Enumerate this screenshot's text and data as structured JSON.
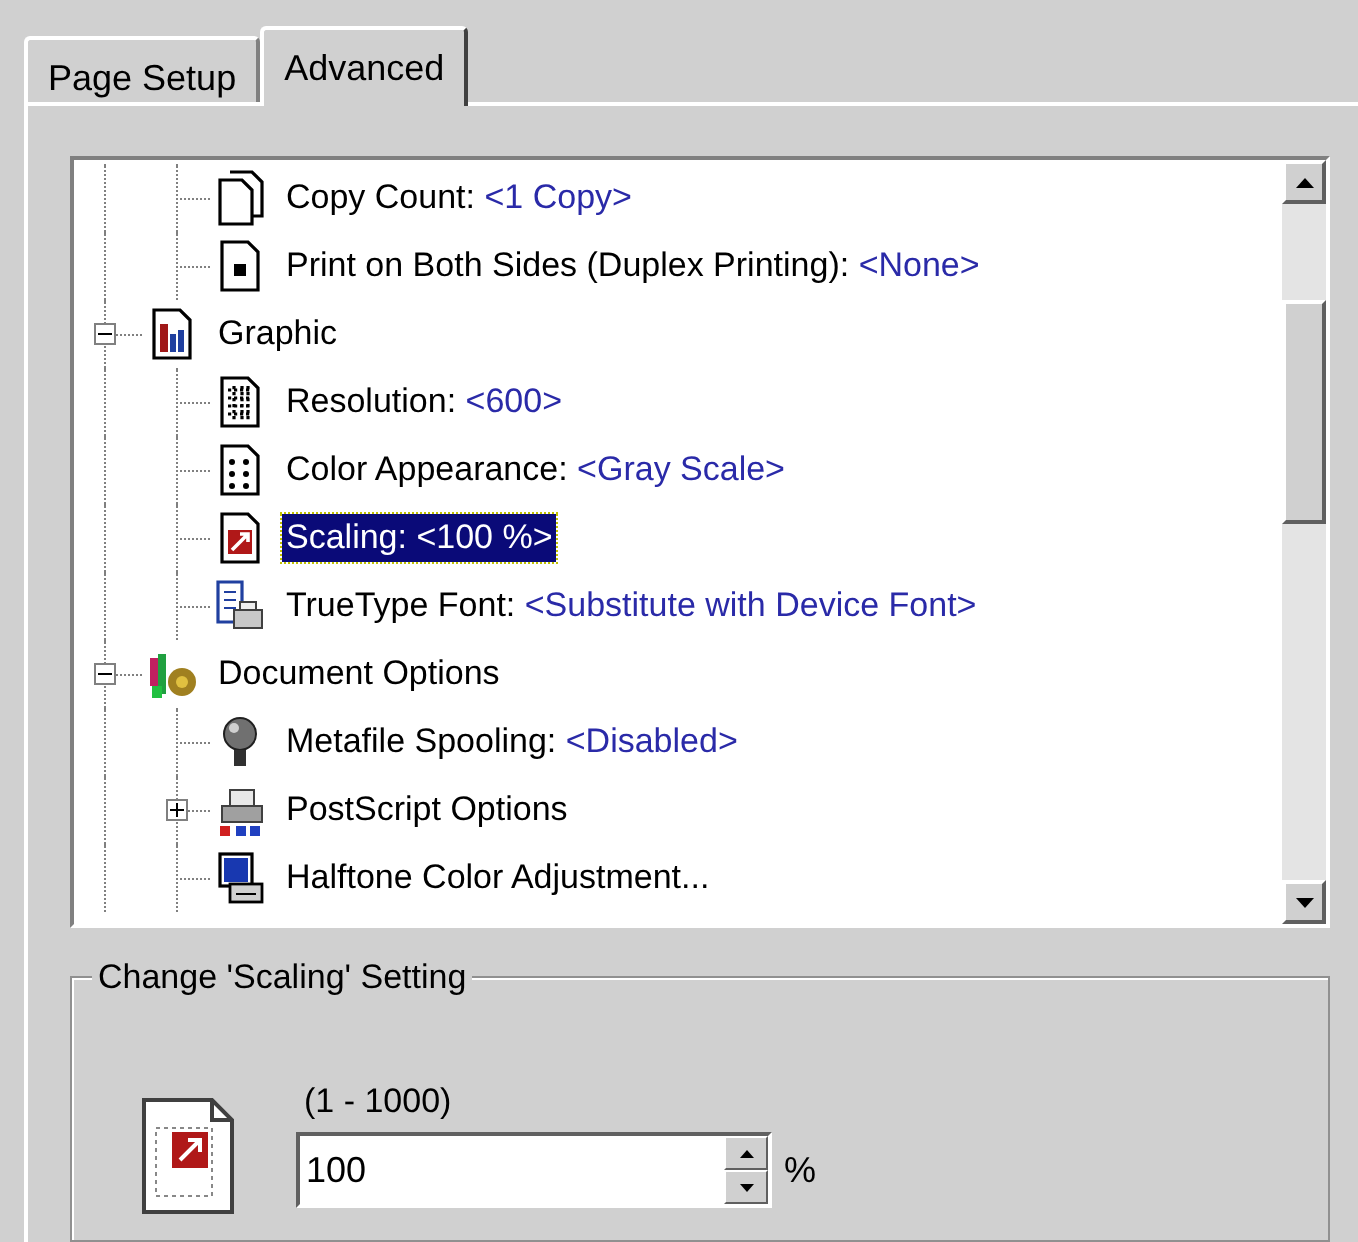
{
  "tabs": [
    {
      "label": "Page Setup",
      "selected": false
    },
    {
      "label": "Advanced",
      "selected": true
    }
  ],
  "tree": {
    "items": [
      {
        "children": [
          {
            "kind": "document",
            "label": "Copy Count: ",
            "value": "<1 Copy>",
            "selected": false
          },
          {
            "kind": "duplex",
            "label": "Print on Both Sides (Duplex Printing): ",
            "value": "<None>",
            "selected": false
          }
        ]
      },
      {
        "kind": "chart",
        "label": "Graphic",
        "selected": false,
        "expanded": true,
        "children": [
          {
            "kind": "grid",
            "label": "Resolution: ",
            "value": "<600>",
            "selected": false
          },
          {
            "kind": "dots",
            "label": "Color Appearance: ",
            "value": "<Gray Scale>",
            "selected": false
          },
          {
            "kind": "scaling",
            "label": "Scaling: ",
            "value": "<100 %>",
            "selected": true
          },
          {
            "kind": "font",
            "label": "TrueType Font: ",
            "value": "<Substitute with Device Font>",
            "selected": false
          }
        ]
      },
      {
        "kind": "options",
        "label": "Document Options",
        "selected": false,
        "expanded": true,
        "children": [
          {
            "kind": "bulb",
            "label": "Metafile Spooling: ",
            "value": "<Disabled>",
            "selected": false
          },
          {
            "kind": "printer",
            "label": "PostScript Options",
            "selected": false,
            "expanded": false
          },
          {
            "kind": "halftone",
            "label": "Halftone Color Adjustment...",
            "selected": false
          }
        ]
      }
    ]
  },
  "setting": {
    "title": "Change 'Scaling' Setting",
    "range": "(1 - 1000)",
    "value": "100",
    "unit": "%"
  }
}
